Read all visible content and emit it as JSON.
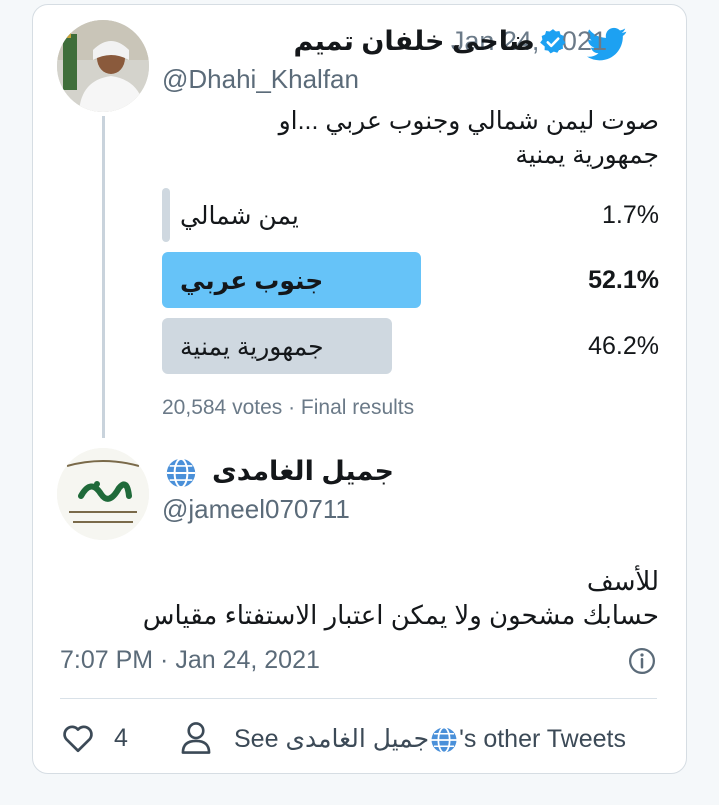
{
  "tweet": {
    "date": "· Jan 24, 2021",
    "author_name": "ضاحى خلفان تميم",
    "author_handle": "@Dhahi_Khalfan",
    "text": "صوت ليمن شمالي وجنوب عربي ...او جمهورية يمنية",
    "poll": {
      "options": [
        {
          "label": "يمن شمالي",
          "percent": "1.7%",
          "share": 0.017
        },
        {
          "label": "جنوب عربي",
          "percent": "52.1%",
          "share": 0.521,
          "winner": true
        },
        {
          "label": "جمهورية يمنية",
          "percent": "46.2%",
          "share": 0.462
        }
      ],
      "summary": "20,584 votes · Final results"
    }
  },
  "reply": {
    "author_name": "جميل الغامدى",
    "author_handle": "@jameel070711",
    "line1": "للأسف",
    "line2": "حسابك مشحون ولا يمكن اعتبار الاستفتاء مقياس",
    "meta": "7:07 PM · Jan 24, 2021",
    "like_count": "4",
    "see_prefix": "See",
    "see_name": "جميل الغامدى",
    "see_suffix": "'s other Tweets"
  },
  "colors": {
    "brand": "#1da1f2",
    "winner_bar": "#66c3f8",
    "other_bar": "#cfd8e0"
  },
  "icons": [
    "twitter-bird-icon",
    "verified-badge-icon",
    "globe-icon",
    "info-icon",
    "heart-icon",
    "person-icon"
  ]
}
